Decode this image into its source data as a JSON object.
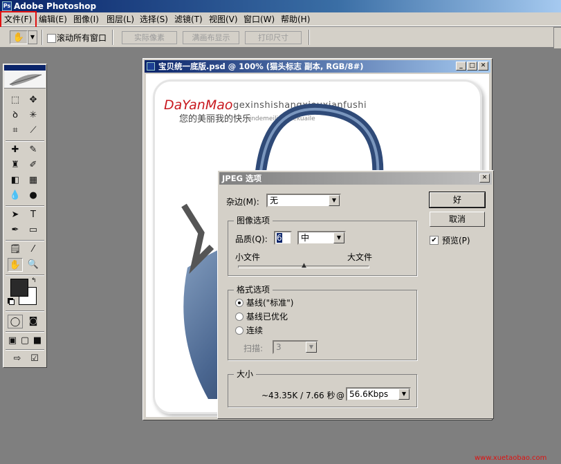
{
  "app": {
    "title": "Adobe Photoshop",
    "icon": "photoshop-icon"
  },
  "menu": [
    "文件(F)",
    "编辑(E)",
    "图像(I)",
    "图层(L)",
    "选择(S)",
    "滤镜(T)",
    "视图(V)",
    "窗口(W)",
    "帮助(H)"
  ],
  "options_bar": {
    "scroll_all_label": "滚动所有窗口",
    "scroll_all_checked": false,
    "actual_pixels": "实际像素",
    "fit_on_screen": "满画布显示",
    "print_size": "打印尺寸"
  },
  "document": {
    "title": "宝贝统一底版.psd @ 100% (猫头标志 副本, RGB/8#)",
    "brand": "DaYanMao",
    "brand_sub": "gexinshishangxiouxianfushi",
    "slogan": "您的美丽我的快乐",
    "slogan_sub": "nindemeili wodekuaile"
  },
  "dialog": {
    "title": "JPEG 选项",
    "matte_label": "杂边(M):",
    "matte_value": "无",
    "image_options_title": "图像选项",
    "quality_label": "品质(Q):",
    "quality_value": "6",
    "quality_level": "中",
    "small_file": "小文件",
    "large_file": "大文件",
    "quality_fraction": 0.5,
    "format_options_title": "格式选项",
    "format_baseline_std": "基线(\"标准\")",
    "format_baseline_opt": "基线已优化",
    "format_progressive": "连续",
    "format_selected": "baseline_std",
    "scans_label": "扫描:",
    "scans_value": "3",
    "size_title": "大小",
    "size_text": "~43.35K / 7.66 秒",
    "at_symbol": "@",
    "speed": "56.6Kbps",
    "ok": "好",
    "cancel": "取消",
    "preview_label": "预览(P)",
    "preview_checked": true
  },
  "watermark": "www.xuetaobao.com",
  "colors": {
    "highlight_box": "#e01010",
    "title_bar": "#0a246a",
    "foreground": "#2a2a2a",
    "background": "#ffffff"
  }
}
